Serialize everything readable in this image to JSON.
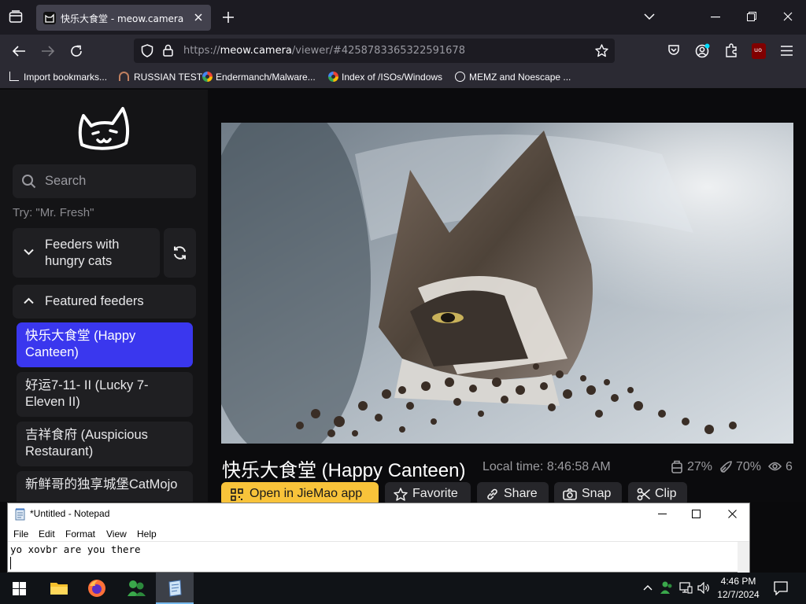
{
  "browser": {
    "tab_title": "快乐大食堂 - meow.camera",
    "url_domain": "meow.camera",
    "url_prefix": "https://",
    "url_path": "/viewer/#4258783365322591678",
    "bookmarks": [
      "Import bookmarks...",
      "RUSSIAN TEST",
      "Endermanch/Malware...",
      "Index of /ISOs/Windows",
      "MEMZ and Noescape ..."
    ],
    "ext_badge": "uo"
  },
  "sidebar": {
    "search_placeholder": "Search",
    "try_hint": "Try: \"Mr. Fresh\"",
    "hungry_label": "Feeders with hungry cats",
    "featured_label": "Featured feeders",
    "feeders": [
      "快乐大食堂 (Happy Canteen)",
      "好运7-11- II (Lucky 7-Eleven II)",
      "吉祥食府 (Auspicious Restaurant)",
      "新鲜哥的独享城堡CatMojo"
    ]
  },
  "main": {
    "title": "快乐大食堂 (Happy Canteen)",
    "local_time": "Local time: 8:46:58 AM",
    "food_pct": "27%",
    "battery_pct": "70%",
    "viewers": "6",
    "buttons": {
      "open_app": "Open in JieMao app",
      "favorite": "Favorite",
      "share": "Share",
      "snap": "Snap",
      "clip": "Clip"
    }
  },
  "notepad": {
    "title": "*Untitled - Notepad",
    "menu": [
      "File",
      "Edit",
      "Format",
      "View",
      "Help"
    ],
    "text": "yo xovbr are you there"
  },
  "taskbar": {
    "time": "4:46 PM",
    "date": "12/7/2024"
  },
  "colors": {
    "accent_selected": "#3a37ee",
    "open_app_button": "#f8c33a"
  }
}
